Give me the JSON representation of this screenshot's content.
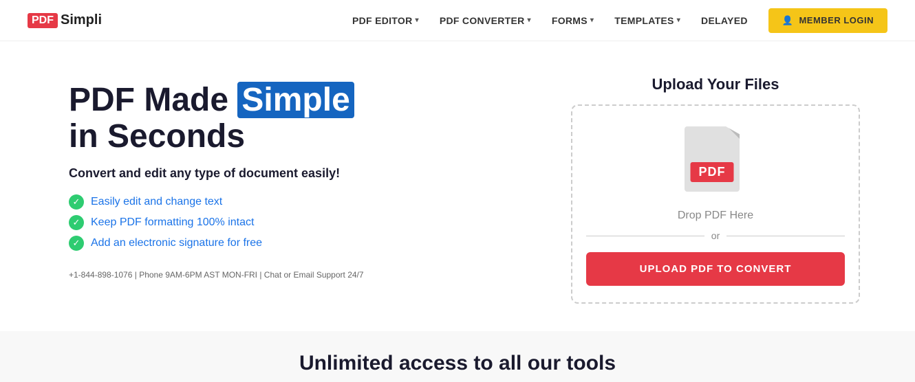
{
  "logo": {
    "pdf": "PDF",
    "simpli": "Simpli"
  },
  "nav": {
    "items": [
      {
        "label": "PDF EDITOR",
        "hasDropdown": true
      },
      {
        "label": "PDF CONVERTER",
        "hasDropdown": true
      },
      {
        "label": "FORMS",
        "hasDropdown": true
      },
      {
        "label": "TEMPLATES",
        "hasDropdown": true
      },
      {
        "label": "DELAYED",
        "hasDropdown": false
      }
    ],
    "member_login": "MEMBER LOGIN"
  },
  "hero": {
    "title_start": "PDF Made ",
    "title_highlight": "Simple",
    "title_end": "in Seconds",
    "subtitle": "Convert and edit any type of document easily!",
    "features": [
      "Easily edit and change text",
      "Keep PDF formatting 100% intact",
      "Add an electronic signature for free"
    ],
    "contact": "+1-844-898-1076 | Phone 9AM-6PM AST MON-FRI | Chat or Email Support 24/7"
  },
  "upload": {
    "title": "Upload Your Files",
    "drop_text": "Drop PDF Here",
    "or_text": "or",
    "button_label": "UPLOAD PDF TO CONVERT",
    "pdf_label": "PDF"
  },
  "bottom": {
    "title": "Unlimited access to all our tools"
  },
  "colors": {
    "accent_red": "#e63946",
    "accent_blue": "#1565c0",
    "accent_yellow": "#f5c518",
    "feature_blue": "#1a73e8",
    "check_green": "#2ecc71"
  }
}
